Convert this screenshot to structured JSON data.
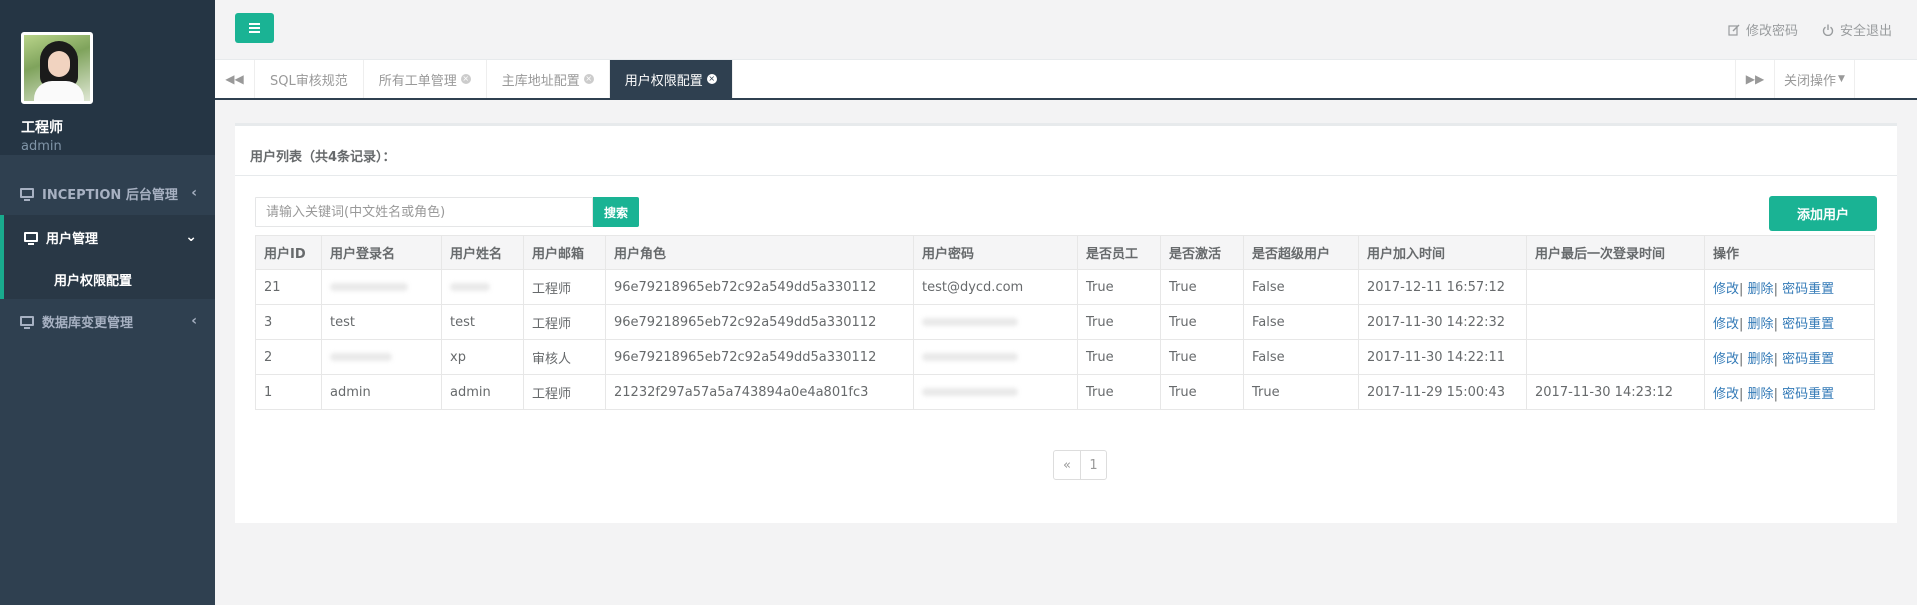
{
  "profile": {
    "name": "工程师",
    "role": "admin"
  },
  "sidebar": {
    "items": [
      {
        "label": "INCEPTION 后台管理",
        "caret": "‹"
      },
      {
        "label": "用户管理",
        "caret": "⌄"
      },
      {
        "label": "用户权限配置"
      },
      {
        "label": "数据库变更管理",
        "caret": "‹"
      }
    ]
  },
  "topbar": {
    "change_password": "修改密码",
    "logout": "安全退出"
  },
  "tabs": {
    "items": [
      {
        "label": "SQL审核规范"
      },
      {
        "label": "所有工单管理"
      },
      {
        "label": "主库地址配置"
      },
      {
        "label": "用户权限配置"
      }
    ],
    "close_ops": "关闭操作"
  },
  "panel": {
    "title": "用户列表（共4条记录）："
  },
  "search": {
    "placeholder": "请输入关键词(中文姓名或角色)",
    "button": "搜索"
  },
  "add_button": "添加用户",
  "table": {
    "headers": [
      "用户ID",
      "用户登录名",
      "用户姓名",
      "用户邮箱",
      "用户角色",
      "用户密码",
      "是否员工",
      "是否激活",
      "是否超级用户",
      "用户加入时间",
      "用户最后一次登录时间",
      "操作"
    ],
    "rows": [
      {
        "id": "21",
        "login": "",
        "name": "",
        "email": "工程师",
        "role": "96e79218965eb72c92a549dd5a330112",
        "password": "test@dycd.com",
        "staff": "True",
        "active": "True",
        "superuser": "False",
        "joined": "2017-12-11 16:57:12",
        "last_login": ""
      },
      {
        "id": "3",
        "login": "test",
        "name": "test",
        "email": "工程师",
        "role": "96e79218965eb72c92a549dd5a330112",
        "password": "",
        "staff": "True",
        "active": "True",
        "superuser": "False",
        "joined": "2017-11-30 14:22:32",
        "last_login": ""
      },
      {
        "id": "2",
        "login": "",
        "name": "xp",
        "email": "审核人",
        "role": "96e79218965eb72c92a549dd5a330112",
        "password": "",
        "staff": "True",
        "active": "True",
        "superuser": "False",
        "joined": "2017-11-30 14:22:11",
        "last_login": ""
      },
      {
        "id": "1",
        "login": "admin",
        "name": "admin",
        "email": "工程师",
        "role": "21232f297a57a5a743894a0e4a801fc3",
        "password": "",
        "staff": "True",
        "active": "True",
        "superuser": "True",
        "joined": "2017-11-29 15:00:43",
        "last_login": "2017-11-30 14:23:12"
      }
    ],
    "ops": {
      "edit": "修改",
      "delete": "删除",
      "reset": "密码重置"
    }
  },
  "pager": {
    "prev": "«",
    "page": "1"
  },
  "icons": {
    "menu": "menu-icon",
    "edit": "edit-icon",
    "power": "power-icon",
    "monitor": "monitor-icon"
  },
  "colors": {
    "accent": "#1ab394",
    "sidebar": "#2f4050",
    "link": "#337ab7"
  }
}
